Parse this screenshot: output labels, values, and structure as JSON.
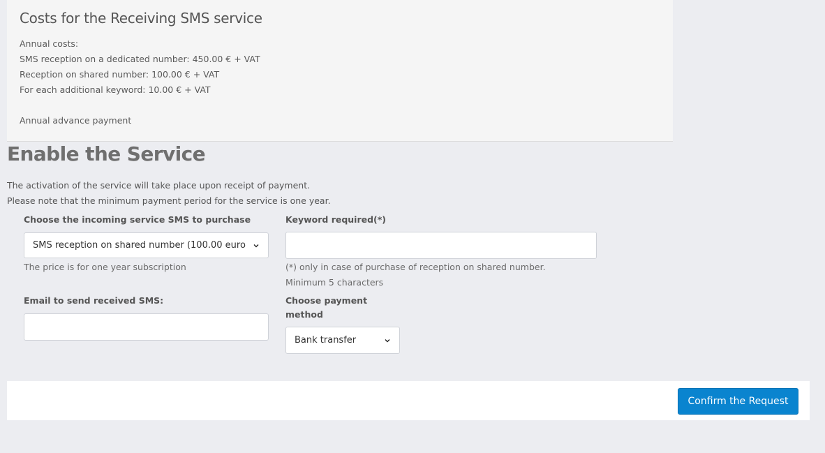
{
  "costs": {
    "title": "Costs for the Receiving SMS service",
    "annual_label": "Annual costs:",
    "dedicated": "SMS reception on a dedicated number: 450.00 € + VAT",
    "shared": "Reception on shared number: 100.00 € + VAT",
    "keyword": "For each additional keyword: 10.00 € + VAT",
    "advance": "Annual advance payment"
  },
  "enable": {
    "title": "Enable the Service",
    "note1": "The activation of the service will take place upon receipt of payment.",
    "note2": "Please note that the minimum payment period for the service is one year."
  },
  "form": {
    "service_label": "Choose the incoming service SMS to purchase",
    "service_value": "SMS reception on shared number (100.00 euro",
    "service_help": "The price is for one year subscription",
    "keyword_label": "Keyword required(*)",
    "keyword_value": "",
    "keyword_help1": "(*) only in case of purchase of reception on shared number.",
    "keyword_help2": "Minimum 5 characters",
    "email_label": "Email to send received SMS:",
    "email_value": "",
    "payment_label_line1": "Choose payment",
    "payment_label_line2": "method",
    "payment_value": "Bank transfer"
  },
  "actions": {
    "confirm_label": "Confirm the Request"
  },
  "icons": {
    "select_arrow": "chevron-down-icon"
  }
}
